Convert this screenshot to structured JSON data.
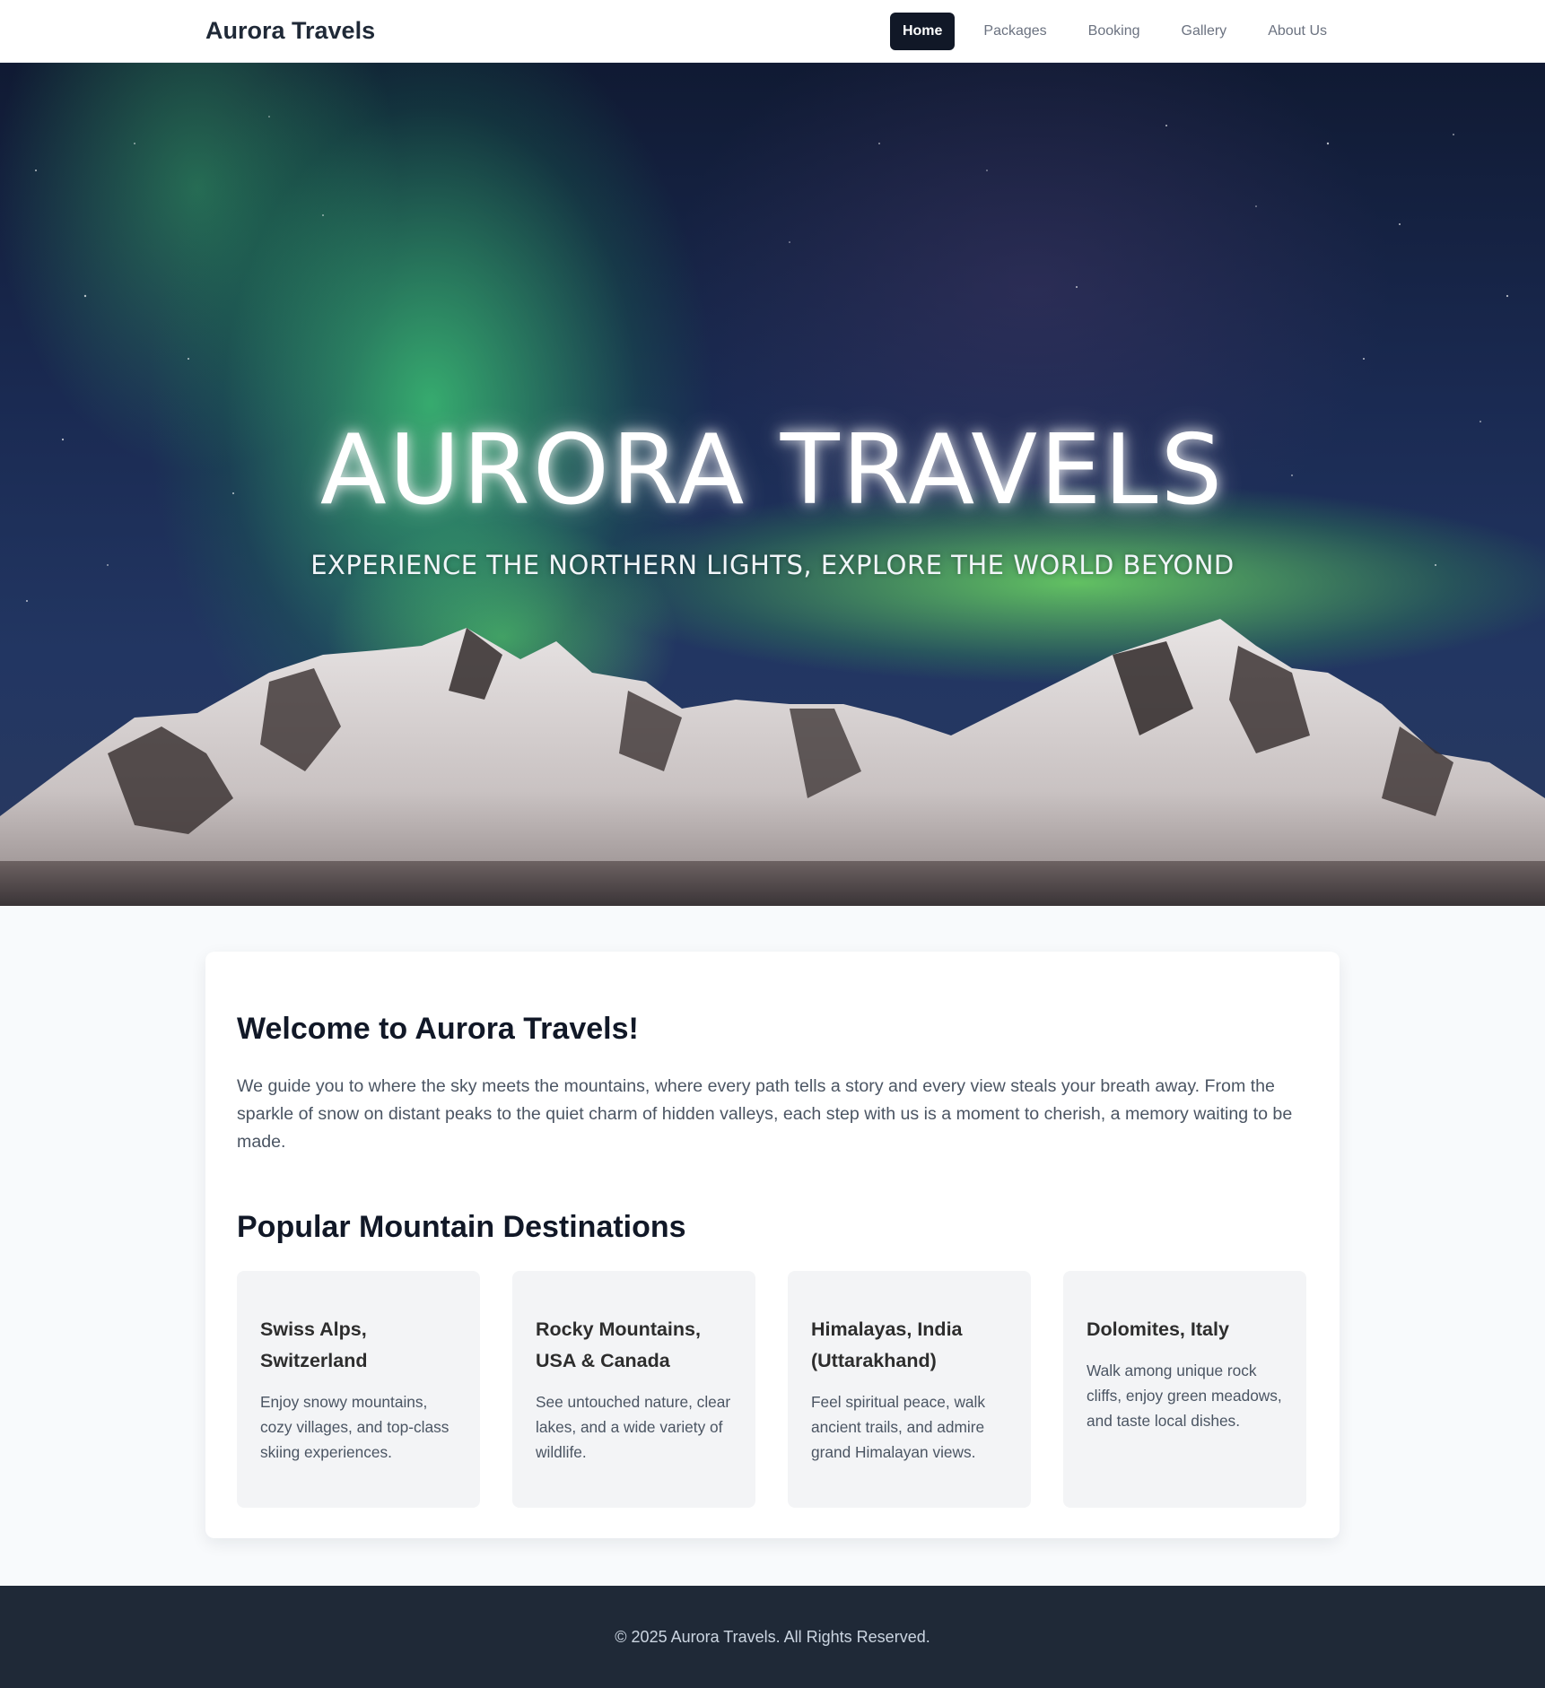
{
  "nav": {
    "brand": "Aurora Travels",
    "links": [
      {
        "label": "Home",
        "active": true
      },
      {
        "label": "Packages",
        "active": false
      },
      {
        "label": "Booking",
        "active": false
      },
      {
        "label": "Gallery",
        "active": false
      },
      {
        "label": "About Us",
        "active": false
      }
    ]
  },
  "hero": {
    "title": "AURORA TRAVELS",
    "subtitle": "EXPERIENCE THE NORTHERN LIGHTS, EXPLORE THE WORLD BEYOND"
  },
  "welcome": {
    "title": "Welcome to Aurora Travels!",
    "text": "We guide you to where the sky meets the mountains, where every path tells a story and every view steals your breath away. From the sparkle of snow on distant peaks to the quiet charm of hidden valleys, each step with us is a moment to cherish, a memory waiting to be made."
  },
  "destinations": {
    "title": "Popular Mountain Destinations",
    "items": [
      {
        "name": "Swiss Alps, Switzerland",
        "desc": "Enjoy snowy mountains, cozy villages, and top-class skiing experiences."
      },
      {
        "name": "Rocky Mountains, USA & Canada",
        "desc": "See untouched nature, clear lakes, and a wide variety of wildlife."
      },
      {
        "name": "Himalayas, India (Uttarakhand)",
        "desc": "Feel spiritual peace, walk ancient trails, and admire grand Himalayan views."
      },
      {
        "name": "Dolomites, Italy",
        "desc": "Walk among unique rock cliffs, enjoy green meadows, and taste local dishes."
      }
    ]
  },
  "footer": {
    "text": "© 2025 Aurora Travels. All Rights Reserved."
  },
  "colors": {
    "nav_active_bg": "#111827",
    "footer_bg": "#1f2937",
    "aurora_green": "#3ddc84"
  }
}
